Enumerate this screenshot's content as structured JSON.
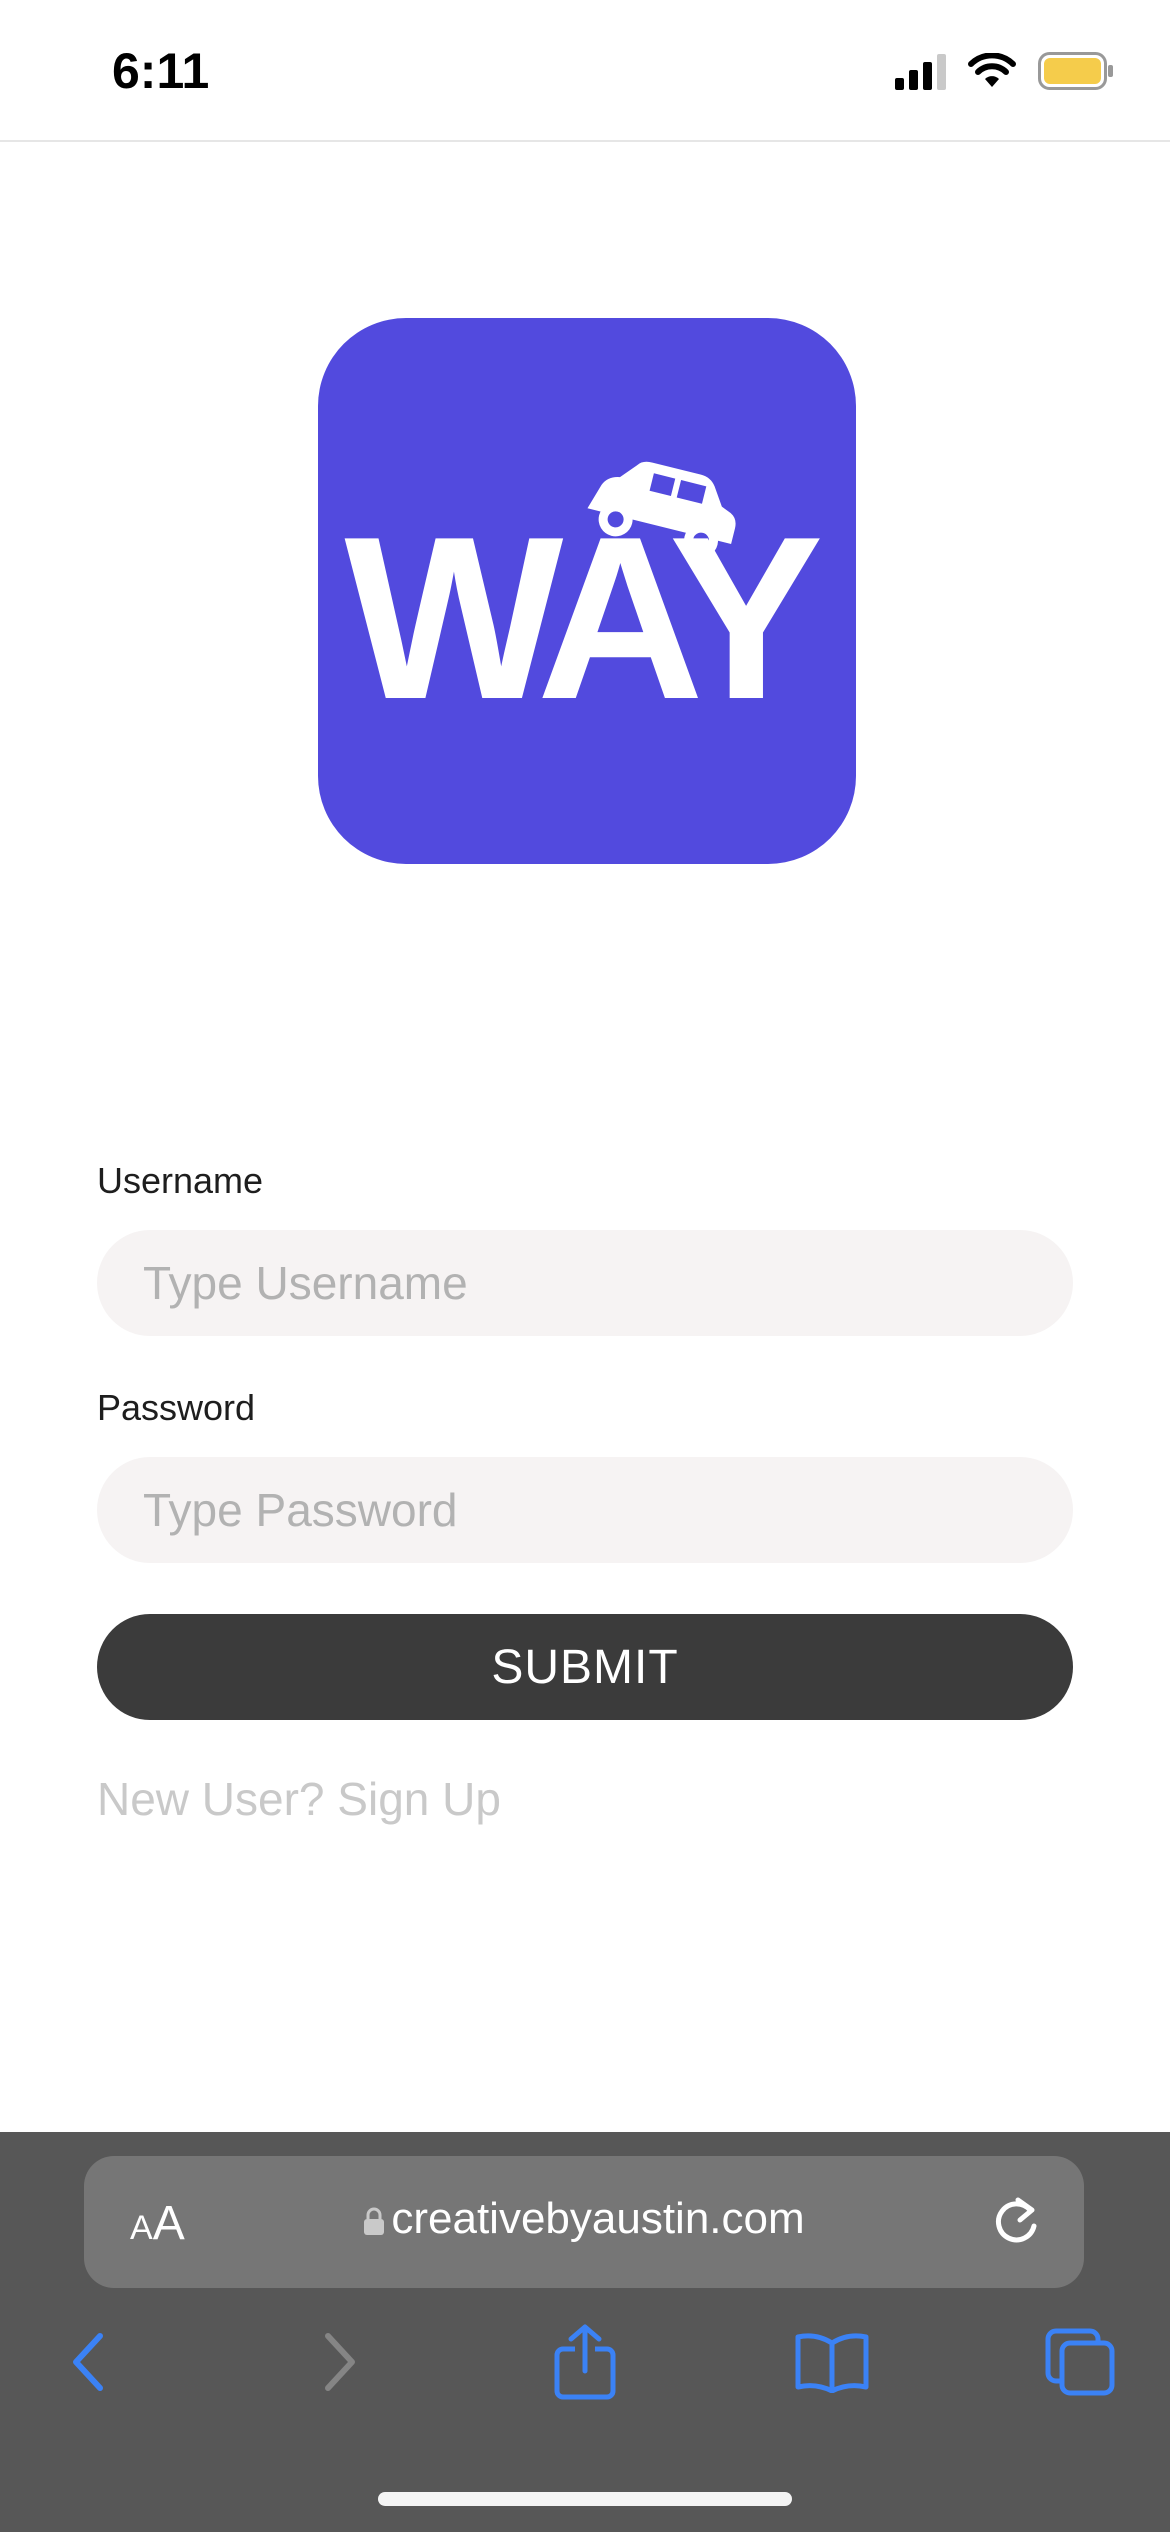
{
  "status": {
    "time": "6:11",
    "battery_color": "#f5cc4b"
  },
  "logo": {
    "text": "WAY",
    "bg_color": "#524ade",
    "icon": "car-icon"
  },
  "form": {
    "username_label": "Username",
    "username_placeholder": "Type Username",
    "password_label": "Password",
    "password_placeholder": "Type Password",
    "submit_label": "SUBMIT",
    "signup_link": "New User? Sign Up"
  },
  "browser": {
    "aa_small": "A",
    "aa_big": "A",
    "url": "creativebyaustin.com",
    "accent_color": "#3b82f6"
  }
}
